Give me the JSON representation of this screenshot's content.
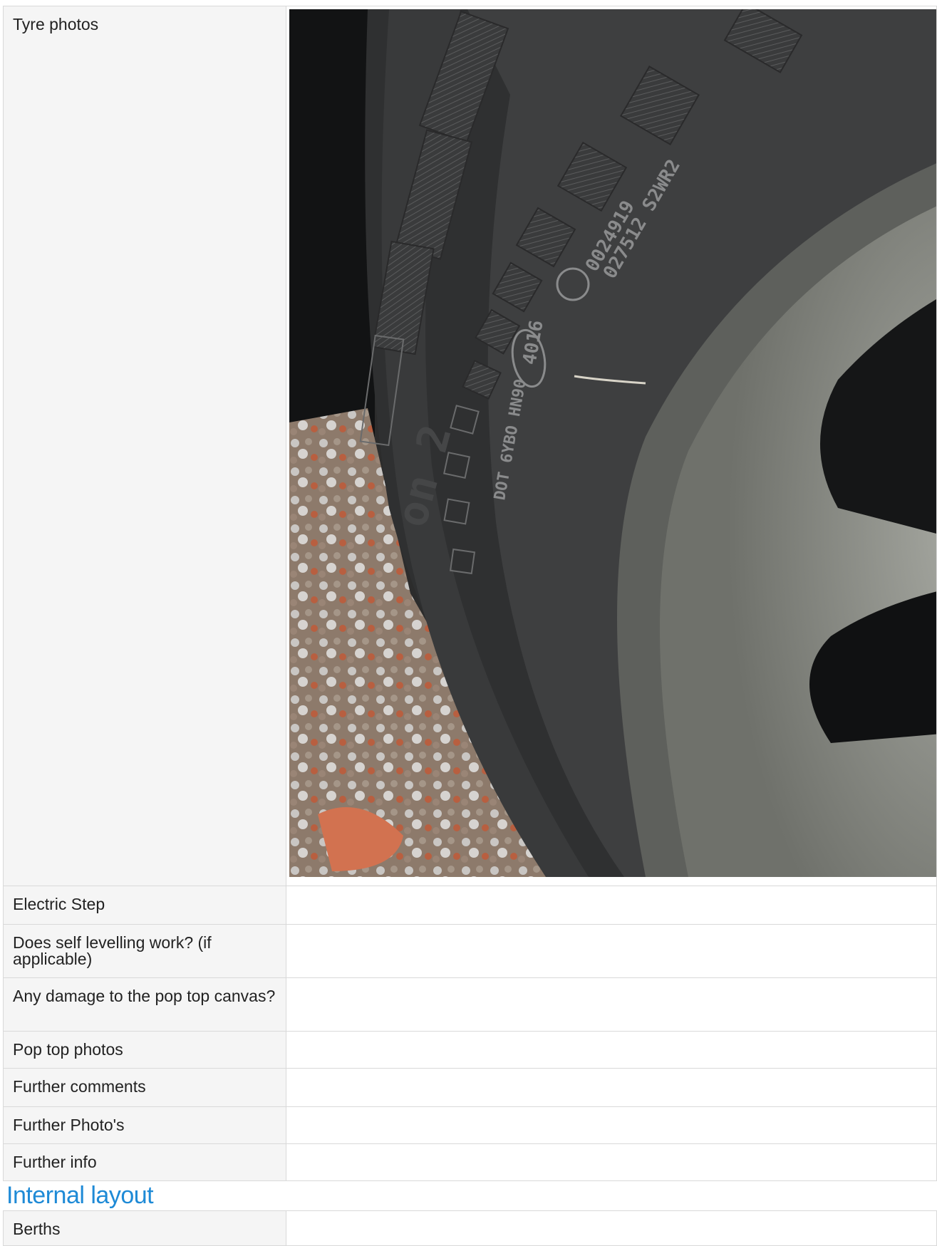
{
  "vehicle_check": {
    "rows": [
      {
        "label": "Tyre photos",
        "value": "",
        "photo": "tyre-sidewall-photo"
      },
      {
        "label": "Electric Step",
        "value": ""
      },
      {
        "label": "Does self levelling work? (if applicable)",
        "value": ""
      },
      {
        "label": "Any damage to the pop top canvas?",
        "value": ""
      },
      {
        "label": "Pop top photos",
        "value": ""
      },
      {
        "label": "Further comments",
        "value": ""
      },
      {
        "label": "Further Photo's",
        "value": ""
      },
      {
        "label": "Further info",
        "value": ""
      }
    ]
  },
  "internal_layout": {
    "heading": "Internal layout",
    "rows": [
      {
        "label": "Berths",
        "value": ""
      }
    ]
  },
  "colors": {
    "heading": "#1e8ad6",
    "label_background": "#f5f5f5",
    "border": "#d9d9d9"
  }
}
